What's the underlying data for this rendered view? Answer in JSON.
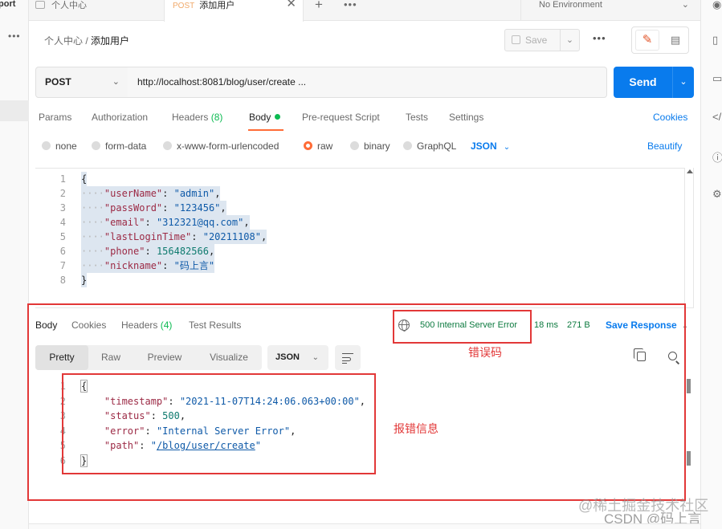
{
  "left_sidebar": {
    "label_partial": "port",
    "dots": "•••"
  },
  "tabs": {
    "items": [
      {
        "label": "个人中心"
      },
      {
        "method": "POST",
        "label": "添加用户"
      }
    ],
    "close": "✕",
    "plus": "+",
    "more": "•••"
  },
  "environment": {
    "label": "No Environment",
    "chevron": "⌄"
  },
  "breadcrumb": {
    "parent": "个人中心",
    "sep": "/",
    "current": "添加用户"
  },
  "toolbar": {
    "save_label": "Save",
    "caret": "⌄",
    "more": "•••"
  },
  "request": {
    "method": "POST",
    "url": "http://localhost:8081/blog/user/create ...",
    "send_label": "Send",
    "caret": "⌄"
  },
  "request_tabs": [
    {
      "label": "Params"
    },
    {
      "label": "Authorization"
    },
    {
      "label": "Headers",
      "count": "(8)"
    },
    {
      "label": "Body"
    },
    {
      "label": "Pre-request Script"
    },
    {
      "label": "Tests"
    },
    {
      "label": "Settings"
    }
  ],
  "cookies_label": "Cookies",
  "body_types": [
    {
      "label": "none"
    },
    {
      "label": "form-data"
    },
    {
      "label": "x-www-form-urlencoded"
    },
    {
      "label": "raw"
    },
    {
      "label": "binary"
    },
    {
      "label": "GraphQL"
    }
  ],
  "body_format": "JSON",
  "beautify_label": "Beautify",
  "request_body_lines": [
    {
      "n": "1",
      "parts": [
        [
          "p",
          "{"
        ]
      ]
    },
    {
      "n": "2",
      "parts": [
        [
          "d",
          "····"
        ],
        [
          "k",
          "\"userName\""
        ],
        [
          "p",
          ": "
        ],
        [
          "s",
          "\"admin\""
        ],
        [
          "p",
          ","
        ]
      ]
    },
    {
      "n": "3",
      "parts": [
        [
          "d",
          "····"
        ],
        [
          "k",
          "\"passWord\""
        ],
        [
          "p",
          ": "
        ],
        [
          "s",
          "\"123456\""
        ],
        [
          "p",
          ","
        ]
      ]
    },
    {
      "n": "4",
      "parts": [
        [
          "d",
          "····"
        ],
        [
          "k",
          "\"email\""
        ],
        [
          "p",
          ": "
        ],
        [
          "s",
          "\"312321@qq.com\""
        ],
        [
          "p",
          ","
        ]
      ]
    },
    {
      "n": "5",
      "parts": [
        [
          "d",
          "····"
        ],
        [
          "k",
          "\"lastLoginTime\""
        ],
        [
          "p",
          ": "
        ],
        [
          "s",
          "\"20211108\""
        ],
        [
          "p",
          ","
        ]
      ]
    },
    {
      "n": "6",
      "parts": [
        [
          "d",
          "····"
        ],
        [
          "k",
          "\"phone\""
        ],
        [
          "p",
          ": "
        ],
        [
          "n",
          "156482566"
        ],
        [
          "p",
          ","
        ]
      ]
    },
    {
      "n": "7",
      "parts": [
        [
          "d",
          "····"
        ],
        [
          "k",
          "\"nickname\""
        ],
        [
          "p",
          ": "
        ],
        [
          "s",
          "\"码上言\""
        ]
      ]
    },
    {
      "n": "8",
      "parts": [
        [
          "p",
          "}"
        ]
      ]
    }
  ],
  "response_tabs": [
    {
      "label": "Body"
    },
    {
      "label": "Cookies"
    },
    {
      "label": "Headers",
      "count": "(4)"
    },
    {
      "label": "Test Results"
    }
  ],
  "response_meta": {
    "status": "500 Internal Server Error",
    "time": "18 ms",
    "size": "271 B",
    "save_label": "Save Response",
    "caret": "⌄"
  },
  "response_views": [
    {
      "label": "Pretty"
    },
    {
      "label": "Raw"
    },
    {
      "label": "Preview"
    },
    {
      "label": "Visualize"
    }
  ],
  "response_format": "JSON",
  "response_body_lines": [
    {
      "n": "1",
      "parts": [
        [
          "p",
          "{"
        ]
      ]
    },
    {
      "n": "2",
      "parts": [
        [
          "k",
          "    \"timestamp\""
        ],
        [
          "p",
          ": "
        ],
        [
          "s",
          "\"2021-11-07T14:24:06.063+00:00\""
        ],
        [
          "p",
          ","
        ]
      ]
    },
    {
      "n": "3",
      "parts": [
        [
          "k",
          "    \"status\""
        ],
        [
          "p",
          ": "
        ],
        [
          "n",
          "500"
        ],
        [
          "p",
          ","
        ]
      ]
    },
    {
      "n": "4",
      "parts": [
        [
          "k",
          "    \"error\""
        ],
        [
          "p",
          ": "
        ],
        [
          "s",
          "\"Internal Server Error\""
        ],
        [
          "p",
          ","
        ]
      ]
    },
    {
      "n": "5",
      "parts": [
        [
          "k",
          "    \"path\""
        ],
        [
          "p",
          ": "
        ],
        [
          "s",
          "\""
        ],
        [
          "l",
          "/blog/user/create"
        ],
        [
          "s",
          "\""
        ]
      ]
    },
    {
      "n": "6",
      "parts": [
        [
          "p",
          "}"
        ]
      ]
    }
  ],
  "annotations": {
    "error_code": "错误码",
    "error_info": "报错信息"
  },
  "watermark": {
    "line1": "@稀土掘金技术社区",
    "line2": "CSDN @码上言"
  },
  "colors": {
    "accent": "#ff6c37",
    "primary": "#097bed",
    "success": "#0cbb52",
    "annotation": "#e23838"
  }
}
